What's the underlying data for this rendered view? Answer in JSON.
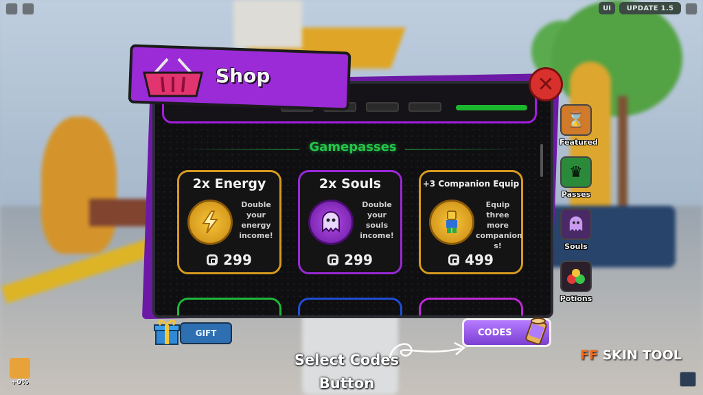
{
  "topbar": {
    "ui_label": "UI",
    "update_label": "UPDATE 1.5"
  },
  "shop": {
    "title": "Shop",
    "section_title": "Gamepasses",
    "close_symbol": "✕",
    "cards": [
      {
        "title": "2x Energy",
        "description": "Double your energy income!",
        "price": "299",
        "icon": "lightning-coin-icon",
        "border": "#d79a1f"
      },
      {
        "title": "2x Souls",
        "description": "Double your souls income!",
        "price": "299",
        "icon": "ghost-icon",
        "border": "#9a28d6"
      },
      {
        "title": "+3 Companion Equip",
        "description": "Equip three more companion s!",
        "price": "499",
        "icon": "companion-coin-icon",
        "border": "#d79a1f"
      }
    ]
  },
  "side_menu": [
    {
      "label": "Featured",
      "icon": "hourglass-icon"
    },
    {
      "label": "Passes",
      "icon": "crown-icon"
    },
    {
      "label": "Souls",
      "icon": "ghost-icon"
    },
    {
      "label": "Potions",
      "icon": "potions-icon"
    }
  ],
  "gift_label": "GIFT",
  "codes_label": "CODES",
  "caption": {
    "line1": "Select Codes",
    "line2": "Button"
  },
  "brand": {
    "ff": "FF",
    "rest": " SKIN TOOL"
  },
  "bottom_left_value": "+0%",
  "colors": {
    "accent_purple": "#9b2ad7",
    "green": "#25c54a",
    "gold": "#d79a1f",
    "close_red": "#d8312d"
  }
}
